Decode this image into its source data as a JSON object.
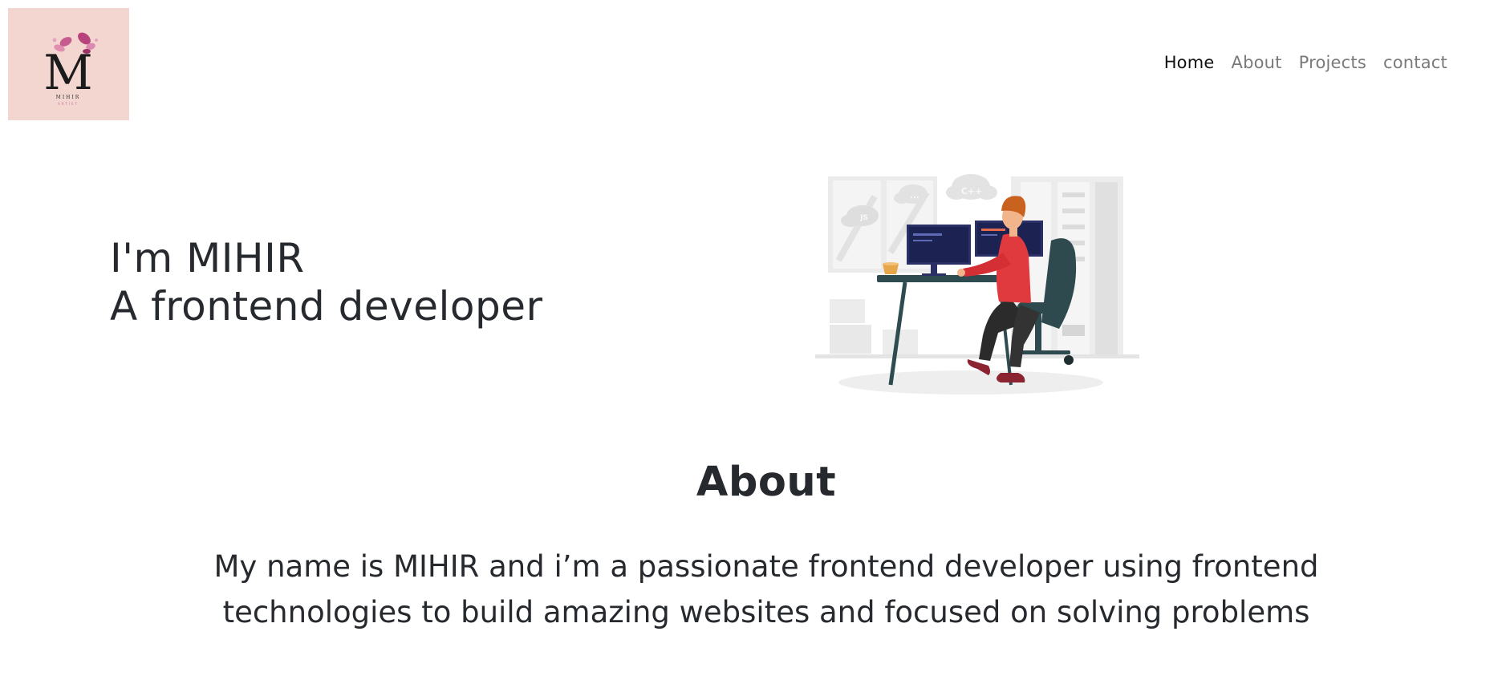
{
  "logo": {
    "letter": "M",
    "name": "MIHIR",
    "subtitle": "ARTIST"
  },
  "nav": {
    "items": [
      {
        "label": "Home",
        "active": true
      },
      {
        "label": "About",
        "active": false
      },
      {
        "label": "Projects",
        "active": false
      },
      {
        "label": "contact",
        "active": false
      }
    ]
  },
  "hero": {
    "line1": "I'm MIHIR",
    "line2": "A frontend developer",
    "illustration": {
      "cloud_labels": [
        "JS",
        "C++",
        "..."
      ]
    }
  },
  "about": {
    "title": "About",
    "text": "My name is MIHIR and i’m a passionate frontend developer using frontend technologies to build amazing websites and focused on solving problems"
  },
  "colors": {
    "logo_bg": "#f4d6d1",
    "nav_active": "#111111",
    "nav_inactive": "#7a7a7a",
    "text": "#26292e",
    "shirt": "#e0393e",
    "chair": "#2f4a4e"
  }
}
